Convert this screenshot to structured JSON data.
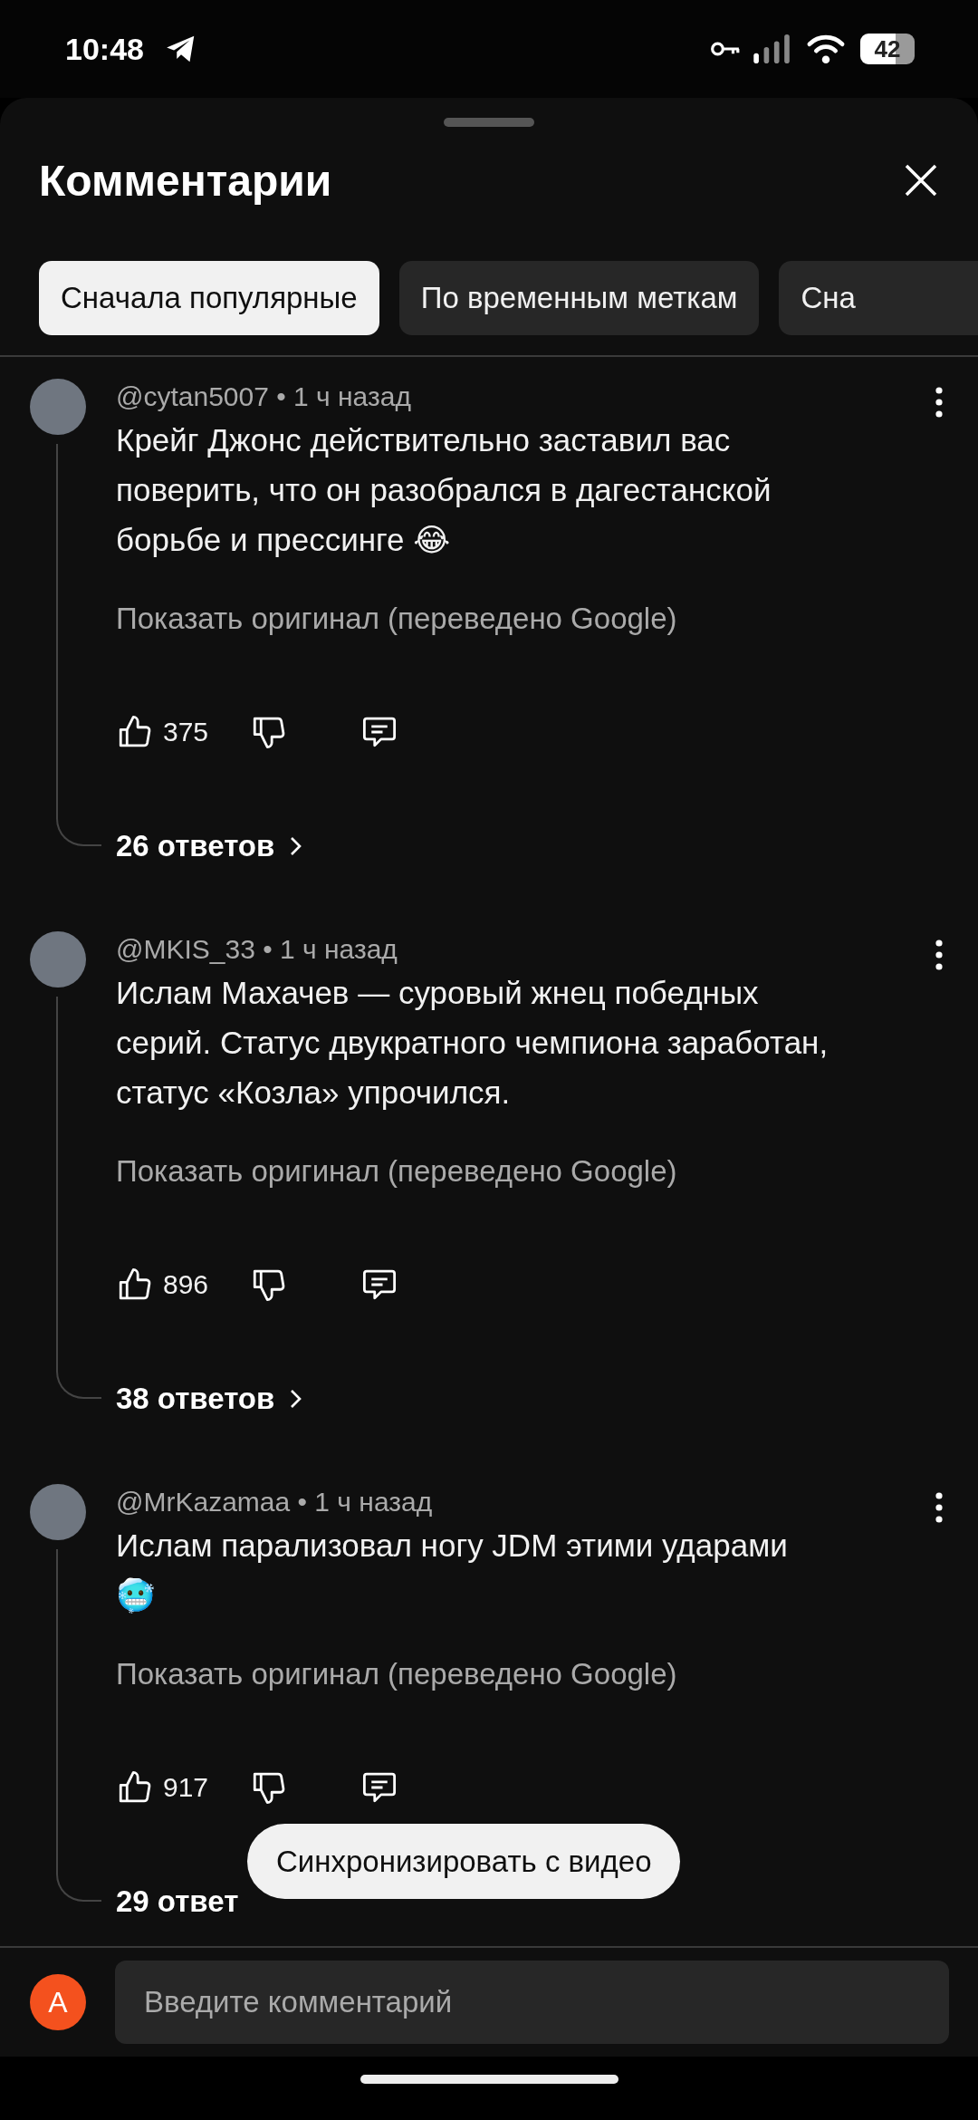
{
  "status_bar": {
    "time": "10:48",
    "battery": "42"
  },
  "sheet": {
    "title": "Комментарии"
  },
  "sort_chips": [
    {
      "label": "Сначала популярные",
      "selected": true
    },
    {
      "label": "По временным меткам",
      "selected": false
    },
    {
      "label": "Сна",
      "selected": false
    }
  ],
  "comments": [
    {
      "meta": "@cytan5007 • 1 ч назад",
      "text": "Крейг Джонс действительно заставил вас поверить, что он разобрался в дагестанской борьбе и прессинге 😂",
      "translation": "Показать оригинал (переведено Google)",
      "likes": "375",
      "replies": "26 ответов",
      "replies_chevron": true
    },
    {
      "meta": "@MKIS_33 • 1 ч назад",
      "text": "Ислам Махачев — суровый жнец победных серий. Статус двукратного чемпиона заработан, статус «Козла» упрочился.",
      "translation": "Показать оригинал (переведено Google)",
      "likes": "896",
      "replies": "38 ответов",
      "replies_chevron": true
    },
    {
      "meta": "@MrKazamaa • 1 ч назад",
      "text": "Ислам парализовал ногу JDM этими ударами 🥶",
      "translation": "Показать оригинал (переведено Google)",
      "likes": "917",
      "replies": "29 ответ",
      "replies_chevron": false
    }
  ],
  "toast": "Синхронизировать с видео",
  "composer": {
    "avatar_letter": "A",
    "placeholder": "Введите комментарий"
  }
}
